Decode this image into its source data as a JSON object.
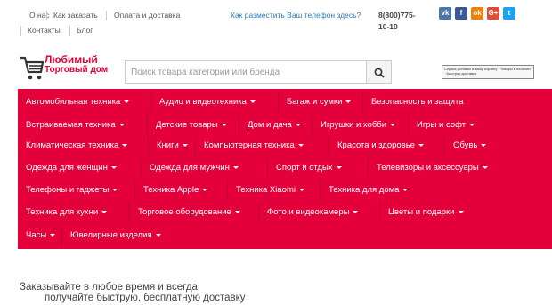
{
  "topnav": {
    "links": [
      "О нас",
      "Как заказать",
      "Оплата и доставка",
      "Контакты",
      "Блог"
    ],
    "phone_question": "Как разместить Ваш телефон здесь?",
    "phone_line1": "8(800)775-",
    "phone_line2": "10-10"
  },
  "social": [
    {
      "name": "vk-icon",
      "label": "vk",
      "color": "#4a76a8"
    },
    {
      "name": "facebook-icon",
      "label": "f",
      "color": "#3b5998"
    },
    {
      "name": "odnoklassniki-icon",
      "label": "ok",
      "color": "#ee8208"
    },
    {
      "name": "google-plus-icon",
      "label": "G+",
      "color": "#dd4b39"
    },
    {
      "name": "twitter-icon",
      "label": "t",
      "color": "#1da1f2"
    }
  ],
  "logo": {
    "line1": "Любимый",
    "line2": "Торговый дом"
  },
  "search": {
    "placeholder": "Поиск товара категории или бренда",
    "button_icon": "search-icon"
  },
  "banner": {
    "text": "Сервис добавки в вашу корзину · Товары в наличии · Быстрая доставка"
  },
  "categories": [
    "Автомобильная техника",
    "Аудио и видеотехника",
    "Багаж и сумки",
    "Безопасность и защита",
    "Встраиваемая техника",
    "Детские товары",
    "Дом и дача",
    "Игрушки и хобби",
    "Игры и софт",
    "Климатическая техника",
    "Книги",
    "Компьютерная техника",
    "Красота и здоровье",
    "Обувь",
    "Одежда для женщин",
    "Одежда для мужчин",
    "Спорт и отдых",
    "Телевизоры и аксессуары",
    "Телефоны и гаджеты",
    "Техника Apple",
    "Техника Xiaomi",
    "Техника для дома",
    "Техника для кухни",
    "Торговое оборудование",
    "Фото и видеокамеры",
    "Цветы и подарки",
    "Часы",
    "Ювелирные изделия"
  ],
  "promo": {
    "line1": "Заказывайте в любое время и всегда",
    "line2": "получайте быструю, бесплатную доставку"
  },
  "colors": {
    "accent": "#e4003a",
    "link": "#2a7bbd"
  }
}
